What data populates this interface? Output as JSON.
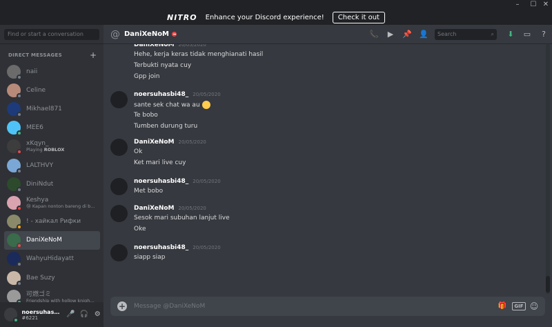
{
  "window": {
    "controls": [
      "–",
      "☐",
      "✕"
    ]
  },
  "nitro_banner": {
    "logo": "NITRO",
    "text": "Enhance your Discord experience!",
    "cta": "Check it out"
  },
  "sidebar": {
    "search_placeholder": "Find or start a conversation",
    "section_label": "DIRECT MESSAGES",
    "add_label": "+",
    "items": [
      {
        "name": "naii",
        "sub": "",
        "avatar_color": "#6b6b6b",
        "status": "offline"
      },
      {
        "name": "Celine",
        "sub": "",
        "avatar_color": "#b88a7a",
        "status": "offline"
      },
      {
        "name": "Mikhael871",
        "sub": "",
        "avatar_color": "#1d3b7a",
        "status": "offline"
      },
      {
        "name": "MEE6",
        "sub": "",
        "avatar_color": "#4fc3f7",
        "status": "online"
      },
      {
        "name": "xKqyn_",
        "sub_prefix": "Playing ",
        "sub": "ROBLOX",
        "avatar_color": "#3d3d3d",
        "status": "dnd"
      },
      {
        "name": "LALTHVY",
        "sub": "",
        "avatar_color": "#7aa7d6",
        "status": "offline"
      },
      {
        "name": "DiniNdut",
        "sub": "",
        "avatar_color": "#2d4a2d",
        "status": "offline"
      },
      {
        "name": "Keshya",
        "sub": "😢 Kapan nonton bareng di b...",
        "avatar_color": "#d9a3b0",
        "status": "dnd"
      },
      {
        "name": "! - хайкал Рифки",
        "sub": "",
        "avatar_color": "#8a8a6a",
        "status": "idle"
      },
      {
        "name": "DaniXeNoM",
        "sub": "",
        "avatar_color": "#3a6b4a",
        "status": "dnd"
      },
      {
        "name": "WahyuHidayatt",
        "sub": "",
        "avatar_color": "#1a2a5a",
        "status": "offline"
      },
      {
        "name": "Bae Suzy",
        "sub": "",
        "avatar_color": "#c9b8a8",
        "status": "offline"
      },
      {
        "name": "可燃ゴミ",
        "sub": "Friendship with hollow knigh...",
        "avatar_color": "#9a9a9a",
        "status": "online"
      }
    ]
  },
  "user_panel": {
    "name": "noersuhasbi...",
    "tag": "#6221",
    "mic_icon": "🎤",
    "headset_icon": "🎧",
    "settings_icon": "⚙"
  },
  "chat_header": {
    "at": "@",
    "name": "DaniXeNoM",
    "search_placeholder": "Search",
    "tools": {
      "call": "📞",
      "video": "▶",
      "pin": "📌",
      "add_friend": "👤",
      "download": "⬇",
      "inbox": "▭",
      "help": "?"
    }
  },
  "messages": [
    {
      "author": "DaniXeNoM",
      "time": "20/05/2020",
      "lines": [
        "Hehe, kerja keras tidak menghianati hasil",
        "Terbukti nyata cuy",
        "Gpp join"
      ]
    },
    {
      "author": "noersuhasbi48_",
      "time": "20/05/2020",
      "lines": [
        "sante sek chat wa au",
        "Te bobo",
        "Tumben durung turu"
      ]
    },
    {
      "author": "DaniXeNoM",
      "time": "20/05/2020",
      "lines": [
        "Ok",
        "Ket mari live cuy"
      ]
    },
    {
      "author": "noersuhasbi48_",
      "time": "20/05/2020",
      "lines": [
        "Met bobo"
      ]
    },
    {
      "author": "DaniXeNoM",
      "time": "20/05/2020",
      "lines": [
        "Sesok mari subuhan lanjut live",
        "Oke"
      ]
    },
    {
      "author": "noersuhasbi48_",
      "time": "20/05/2020",
      "lines": [
        "siapp siap"
      ]
    }
  ],
  "composer": {
    "placeholder": "Message @DaniXeNoM",
    "add": "+",
    "gift_icon": "🎁",
    "gif_label": "GIF",
    "emoji_icon": "☺"
  },
  "colors": {
    "online": "#43b581",
    "idle": "#faa61a",
    "dnd": "#f04747",
    "offline": "#747f8d"
  }
}
